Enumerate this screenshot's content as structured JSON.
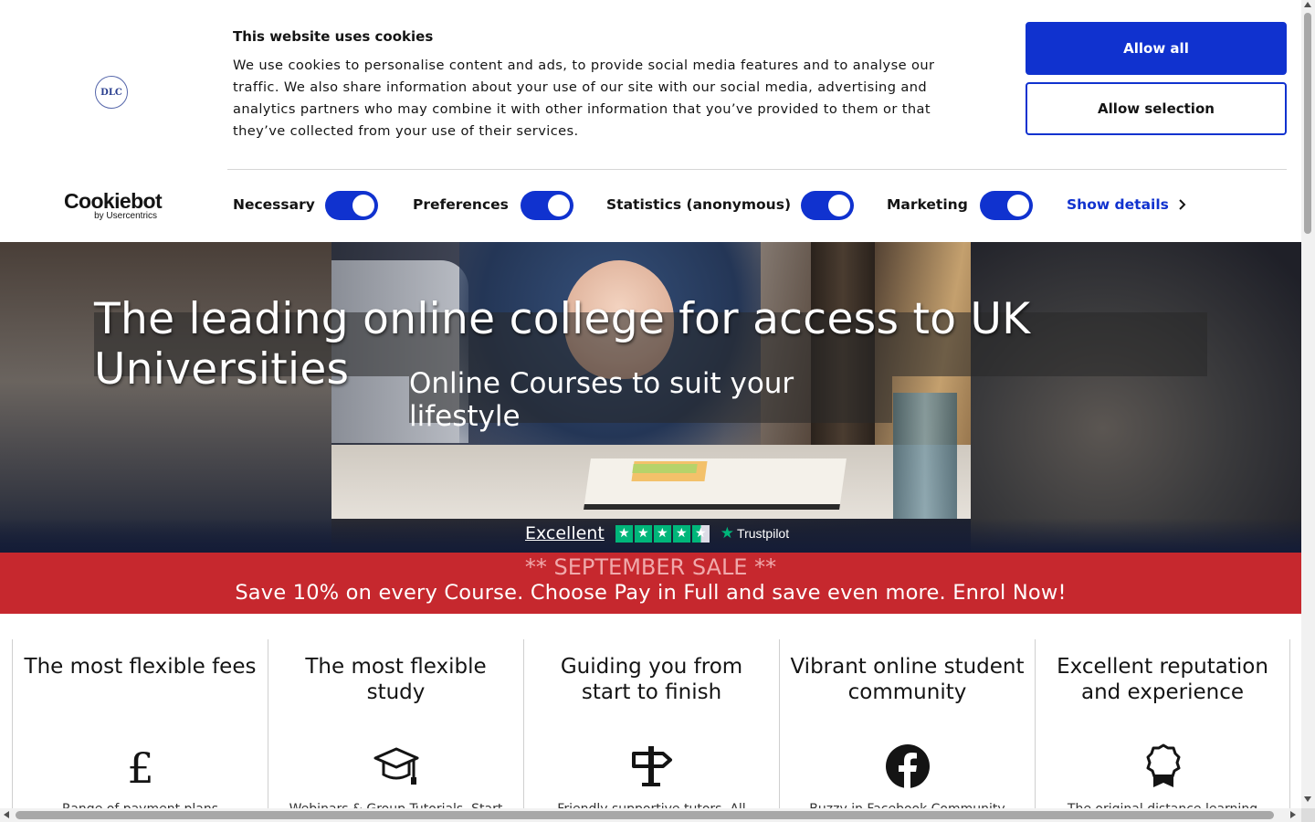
{
  "cookie_banner": {
    "logo_text": "DLC",
    "brand_name": "Cookiebot",
    "brand_sub": "by Usercentrics",
    "title": "This website uses cookies",
    "text": "We use cookies to personalise content and ads, to provide social media features and to analyse our traffic. We also share information about your use of our site with our social media, advertising and analytics partners who may combine it with other information that you’ve provided to them or that they’ve collected from your use of their services.",
    "allow_all": "Allow all",
    "allow_selection": "Allow selection",
    "toggles": [
      {
        "label": "Necessary",
        "checked": true
      },
      {
        "label": "Preferences",
        "checked": true
      },
      {
        "label": "Statistics (anonymous)",
        "checked": true
      },
      {
        "label": "Marketing",
        "checked": true
      }
    ],
    "show_details": "Show details",
    "accent_color": "#1032cf"
  },
  "hero": {
    "title": "The leading online college for access to UK Universities",
    "subtitle": "Online Courses to suit your lifestyle",
    "trustpilot": {
      "rating_text": "Excellent",
      "stars": 4.5,
      "brand": "Trustpilot"
    }
  },
  "sale": {
    "title": "** SEPTEMBER SALE **",
    "text": "Save 10% on every Course. Choose Pay in Full and save even more. Enrol Now!",
    "color": "#c6282e"
  },
  "features": [
    {
      "title": "The most flexible fees",
      "icon": "pound-icon",
      "desc": "Range of payment plans"
    },
    {
      "title": "The most flexible study",
      "icon": "graduation-cap-icon",
      "desc": "Webinars & Group Tutorials, Start"
    },
    {
      "title": "Guiding you from start to finish",
      "icon": "signpost-icon",
      "desc": "Friendly supportive tutors. All"
    },
    {
      "title": "Vibrant online student community",
      "icon": "facebook-icon",
      "desc": "Buzzy in Facebook Community"
    },
    {
      "title": "Excellent reputation and experience",
      "icon": "award-ribbon-icon",
      "desc": "The original distance learning"
    }
  ]
}
